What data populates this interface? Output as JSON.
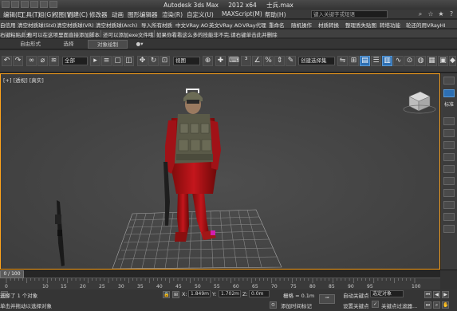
{
  "window": {
    "app_title": "Autodesk 3ds Max",
    "version": "2012 x64",
    "file_name": "士兵.max"
  },
  "menubar": {
    "items": [
      "编辑(E)",
      "工具(T)",
      "组(G)",
      "视图(V)",
      "创建(C)",
      "修改器",
      "动画",
      "图形编辑器",
      "渲染(R)",
      "自定义(U)",
      "MAXScript(M)",
      "帮助(H)"
    ],
    "search_placeholder": "键入关键字或短语"
  },
  "plugin_row1": {
    "items": [
      "自信用",
      "清空材质球(Std)",
      "清空材质球(VR)",
      "清空材质球(Arch)",
      "导入所有材质",
      "中文VRay AO",
      "英文VRay AO",
      "VRay代理",
      "重命名",
      "随机操作",
      "材质转换",
      "整理丢失贴图",
      "转塔功能",
      "轮还的用VRayHI"
    ]
  },
  "plugin_row2": {
    "items": [
      "右键粘贴此无",
      "也可以在这项里面直接添加脚本",
      "还可以添加exe文件哦",
      "如果你看看这么多的技能非不完,请右键单击此并删除"
    ]
  },
  "ribbon": {
    "tabs": [
      "自由形式",
      "选择",
      "对象绘制"
    ],
    "active_index": 2
  },
  "toolbar": {
    "filter_select": "全部",
    "view_select": "视图",
    "selection_set": "创建选择集"
  },
  "viewport": {
    "label": "[+] [透视] [真实]"
  },
  "command_panel": {
    "label": "标准"
  },
  "timeline": {
    "slider_label": "0 / 100",
    "current_frame": 0,
    "total_frames": 100,
    "ticks": [
      "0",
      "10",
      "15",
      "20",
      "25",
      "30",
      "35",
      "40",
      "45",
      "50",
      "55",
      "60",
      "65",
      "70",
      "75",
      "80",
      "85",
      "90",
      "95",
      "100"
    ]
  },
  "statusbar": {
    "status_line1": "选择了 1 个对象",
    "status_line2": "单击并拖动以选择对象",
    "x_label": "X:",
    "x_value": "1.849m",
    "y_label": "Y:",
    "y_value": "1.702m",
    "z_label": "Z:",
    "z_value": "0.0m",
    "grid_label": "栅格 = 0.1m",
    "add_time_tag": "添加时间标记",
    "auto_key": "自动关键点",
    "selected_object": "选定对象",
    "set_key": "设置关键点",
    "key_filters": "关键点过滤器..."
  }
}
